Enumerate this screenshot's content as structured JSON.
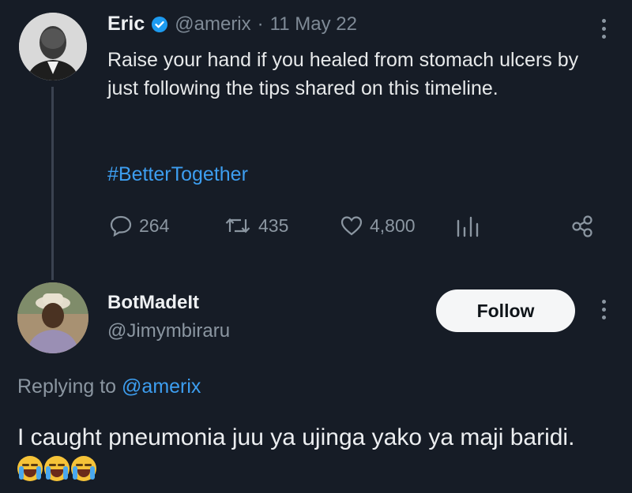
{
  "tweet": {
    "display_name": "Eric",
    "verified_icon": "verified-badge-icon",
    "handle": "@amerix",
    "separator": "·",
    "date": "11 May 22",
    "text": "Raise your hand if you healed from stomach ulcers by just following the tips shared on this timeline.",
    "hashtag": "#BetterTogether",
    "stats": {
      "replies": "264",
      "retweets": "435",
      "likes": "4,800"
    }
  },
  "reply": {
    "display_name": "BotMadeIt",
    "handle": "@Jimymbiraru",
    "follow_label": "Follow",
    "replying_prefix": "Replying to",
    "replying_handle": "@amerix",
    "text": "I caught pneumonia juu ya ujinga yako ya maji baridi.",
    "emoji_icon": "loudly-crying-face-icon"
  },
  "colors": {
    "background": "#161c26",
    "accent": "#1d9bf0",
    "link": "#3d9ef0",
    "muted": "#8b96a1"
  }
}
